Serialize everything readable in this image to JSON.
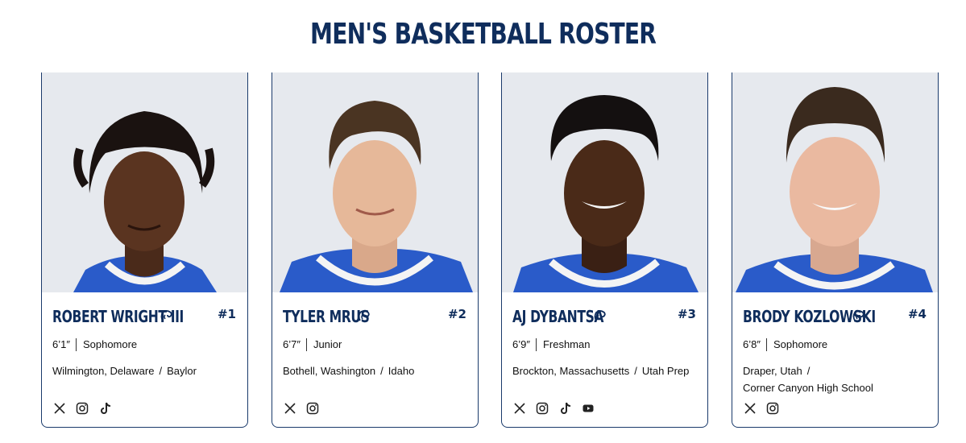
{
  "page": {
    "title": "MEN'S BASKETBALL ROSTER"
  },
  "colors": {
    "navy": "#0f2d5c",
    "jersey_blue": "#2a5bc9",
    "border": "#1a3a6b"
  },
  "players": [
    {
      "name": "ROBERT WRIGHT III",
      "number": "#1",
      "height": "6’1″",
      "class_year": "Sophomore",
      "hometown": "Wilmington, Delaware",
      "previous_school": "Baylor",
      "socials": [
        "x-icon",
        "instagram-icon",
        "tiktok-icon"
      ]
    },
    {
      "name": "TYLER MRUS",
      "number": "#2",
      "height": "6’7″",
      "class_year": "Junior",
      "hometown": "Bothell, Washington",
      "previous_school": "Idaho",
      "socials": [
        "x-icon",
        "instagram-icon"
      ]
    },
    {
      "name": "AJ DYBANTSA",
      "number": "#3",
      "height": "6’9″",
      "class_year": "Freshman",
      "hometown": "Brockton, Massachusetts",
      "previous_school": "Utah Prep",
      "socials": [
        "x-icon",
        "instagram-icon",
        "tiktok-icon",
        "youtube-icon"
      ]
    },
    {
      "name": "BRODY KOZLOWSKI",
      "number": "#4",
      "height": "6’8″",
      "class_year": "Sophomore",
      "hometown": "Draper, Utah",
      "previous_school": "Corner Canyon High School",
      "socials": [
        "x-icon",
        "instagram-icon"
      ]
    }
  ]
}
